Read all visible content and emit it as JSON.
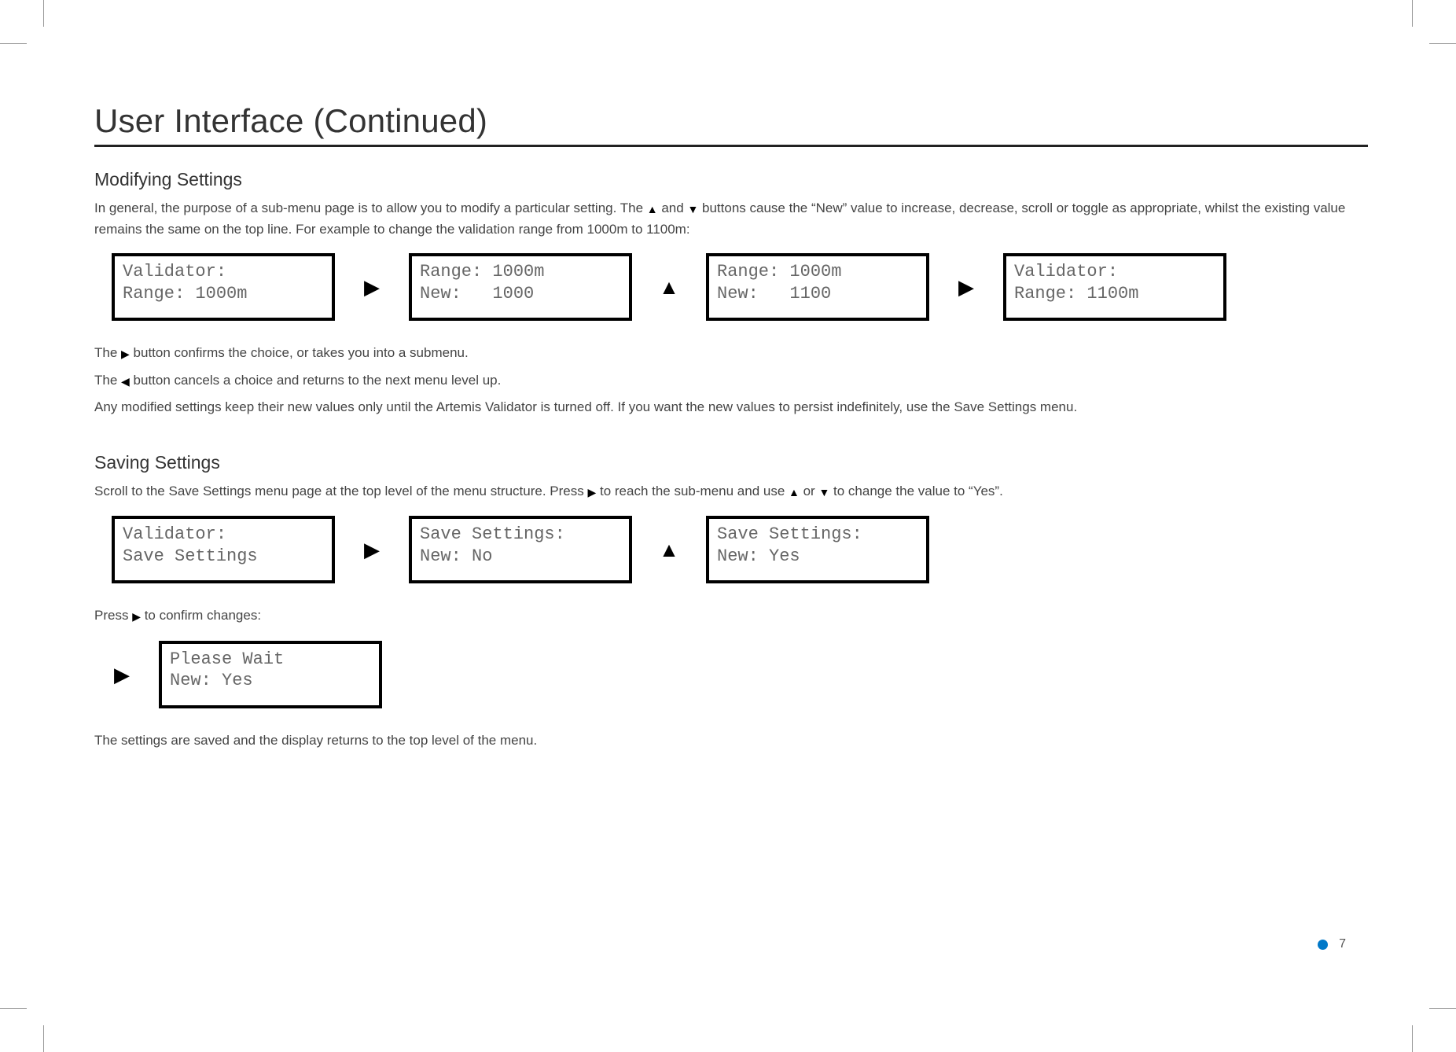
{
  "title": "User Interface (Continued)",
  "section1": {
    "heading": "Modifying Settings",
    "para_pre": "In general, the purpose of a sub-menu page is to allow you to modify a particular setting. The ",
    "para_mid1": " and ",
    "para_mid2": " buttons cause the “New” value to increase, decrease, scroll or toggle as appropriate, whilst the existing value remains the same on the top line. For example to change the validation range from 1000m to 1100m:",
    "screens": [
      {
        "line1": "Validator:",
        "line2": "Range: 1000m"
      },
      {
        "line1": "Range: 1000m",
        "line2": "New:   1000"
      },
      {
        "line1": "Range: 1000m",
        "line2": "New:   1100"
      },
      {
        "line1": "Validator:",
        "line2": "Range: 1100m"
      }
    ],
    "arrows": [
      "right",
      "up",
      "right"
    ],
    "note1_pre": "The ",
    "note1_post": " button confirms the choice, or takes you into a submenu.",
    "note2_pre": "The ",
    "note2_post": " button cancels a choice and returns to the next menu level up.",
    "note3": "Any modified settings keep their new values only until the Artemis Validator is turned off. If you want the new values to persist indefinitely, use the Save Settings menu."
  },
  "section2": {
    "heading": "Saving Settings",
    "para_pre": "Scroll to the Save Settings menu page at the top level of the menu structure. Press ",
    "para_mid1": " to reach the sub-menu and use ",
    "para_mid2": " or ",
    "para_mid3": " to change the value to “Yes”.",
    "screens": [
      {
        "line1": "Validator:",
        "line2": "Save Settings"
      },
      {
        "line1": "Save Settings:",
        "line2": "New: No"
      },
      {
        "line1": "Save Settings:",
        "line2": "New: Yes"
      }
    ],
    "arrows": [
      "right",
      "up"
    ],
    "confirm_pre": "Press ",
    "confirm_post": " to confirm changes:",
    "confirm_screen": {
      "line1": "Please Wait",
      "line2": "New: Yes"
    },
    "closing": "The settings are saved and the display returns to the top level of the menu."
  },
  "page_number": "7"
}
